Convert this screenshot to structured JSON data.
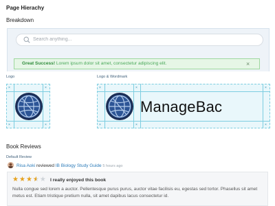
{
  "page": {
    "title": "Page Hierachy",
    "breakdown": "Breakdown"
  },
  "search": {
    "placeholder": "Search anything..."
  },
  "alert": {
    "strong": "Great Success!",
    "text": "Lorem ipsum dolor sit amet, consectetur adipiscing elit.",
    "close": "×"
  },
  "logos": {
    "logo_label": "Logo",
    "wordmark_label": "Logo & Wordmark",
    "wordmark": "ManageBac",
    "guide_mark": "×"
  },
  "reviews": {
    "title": "Book Reviews",
    "default_label": "Default Review",
    "user": "Risa Aoki",
    "action": "reviewed",
    "book": "IB Biology Study Guide",
    "time": "5 hours ago",
    "rating": 3.5,
    "rating_max": 5,
    "headline": "I really enjoyed this book",
    "body": "Nulla congue sed lorem a auctor. Pellentesque purus purus, auctor vitae facilisis eu, egestas sed tortor. Phasellus sit amet metus est. Etiam tristique pretium nulla, sit amet dapibus lacus consectetur id."
  },
  "colors": {
    "accent": "#2a7ab8",
    "success_bg": "#e6f6e6",
    "success_text": "#2e8b3a",
    "guide": "#7ccde0",
    "star": "#e6a21e"
  }
}
